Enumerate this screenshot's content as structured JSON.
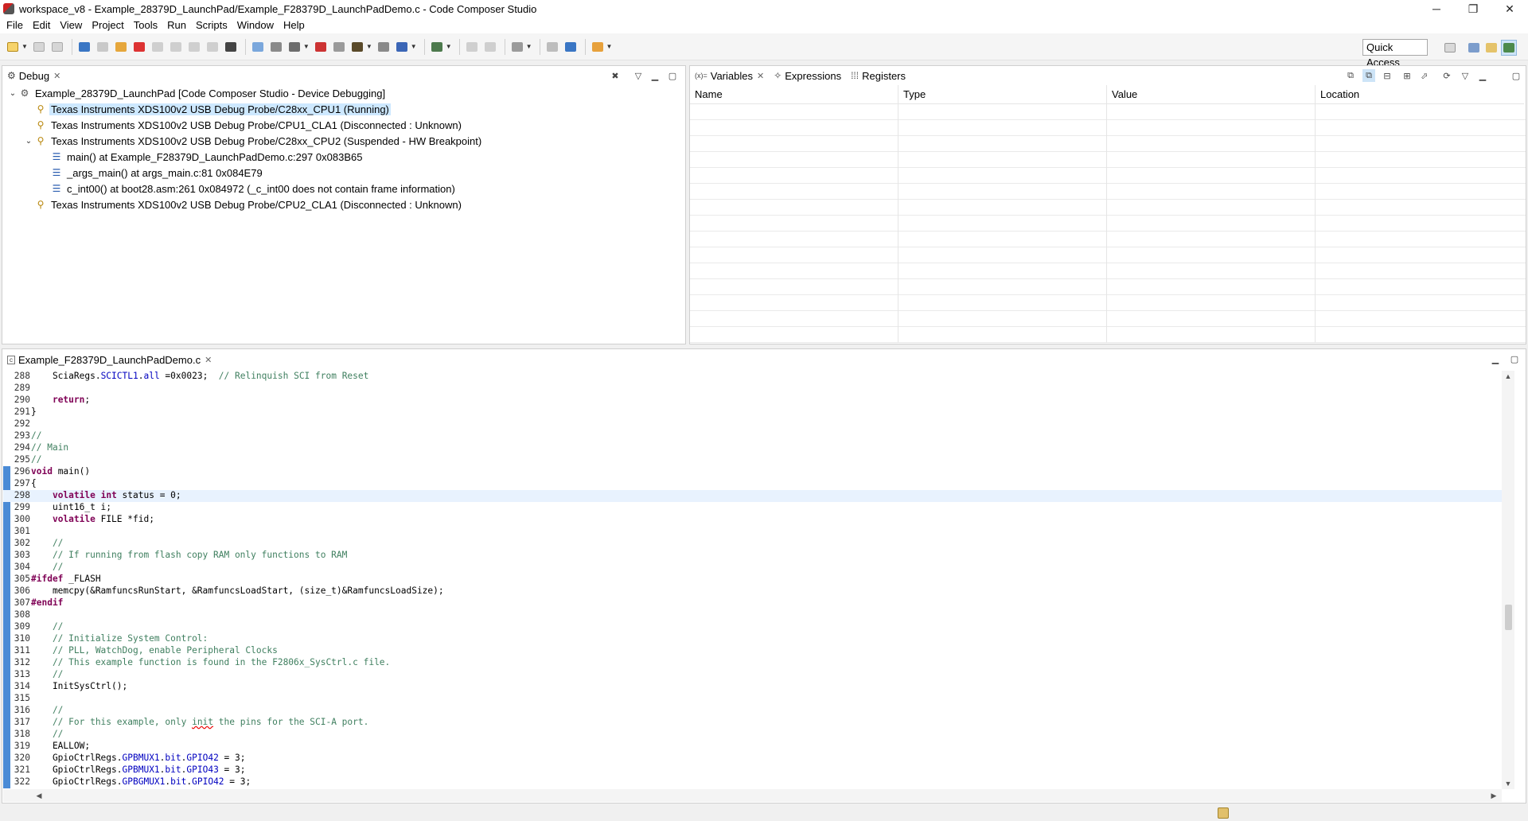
{
  "window": {
    "title": "workspace_v8 - Example_28379D_LaunchPad/Example_F28379D_LaunchPadDemo.c - Code Composer Studio",
    "minimize": "─",
    "restore": "❐",
    "close": "✕"
  },
  "menu": [
    "File",
    "Edit",
    "View",
    "Project",
    "Tools",
    "Run",
    "Scripts",
    "Window",
    "Help"
  ],
  "toolbar": {
    "quick_access": "Quick Access",
    "icons": [
      "new-icon",
      "save-icon",
      "save-all-icon",
      "debug-view-icon",
      "resume-icon",
      "suspend-icon",
      "terminate-icon",
      "step-into-icon",
      "step-over-icon",
      "step-return-icon",
      "reset-icon",
      "memory-browser-icon",
      "connect-icon",
      "flash-icon",
      "breakpoint-icon",
      "skip-breakpoints-icon",
      "build-icon",
      "launch-icon",
      "load-program-icon",
      "settings-gear-icon",
      "assembly-step-into-icon",
      "assembly-step-over-icon",
      "tools-icon",
      "console-icon",
      "search-icon",
      "external-tools-icon"
    ],
    "perspectives": [
      "open-perspective-icon",
      "ccs-edit-perspective-icon",
      "ccs-simple-perspective-icon",
      "ccs-debug-perspective-icon"
    ]
  },
  "debug_view": {
    "tab_label": "Debug",
    "tree": [
      {
        "label": "Example_28379D_LaunchPad [Code Composer Studio - Device Debugging]",
        "level": 0,
        "twisty": "⌄",
        "icon": "launch-config-icon",
        "selected": false
      },
      {
        "label": "Texas Instruments XDS100v2 USB Debug Probe/C28xx_CPU1 (Running)",
        "level": 1,
        "twisty": "",
        "icon": "running-thread-icon",
        "selected": true
      },
      {
        "label": "Texas Instruments XDS100v2 USB Debug Probe/CPU1_CLA1 (Disconnected : Unknown)",
        "level": 1,
        "twisty": "",
        "icon": "disconnected-target-icon",
        "selected": false
      },
      {
        "label": "Texas Instruments XDS100v2 USB Debug Probe/C28xx_CPU2 (Suspended - HW Breakpoint)",
        "level": 1,
        "twisty": "⌄",
        "icon": "suspended-thread-icon",
        "selected": false
      },
      {
        "label": "main() at Example_F28379D_LaunchPadDemo.c:297 0x083B65",
        "level": 2,
        "twisty": "",
        "icon": "stack-frame-icon",
        "selected": false
      },
      {
        "label": "_args_main() at args_main.c:81 0x084E79",
        "level": 2,
        "twisty": "",
        "icon": "stack-frame-icon",
        "selected": false
      },
      {
        "label": "c_int00() at boot28.asm:261 0x084972  (_c_int00 does not contain frame information)",
        "level": 2,
        "twisty": "",
        "icon": "stack-frame-icon",
        "selected": false
      },
      {
        "label": "Texas Instruments XDS100v2 USB Debug Probe/CPU2_CLA1 (Disconnected : Unknown)",
        "level": 1,
        "twisty": "",
        "icon": "disconnected-target-icon",
        "selected": false
      }
    ]
  },
  "variables_view": {
    "tabs": [
      {
        "label": "Variables",
        "icon": "(x)=",
        "closable": true
      },
      {
        "label": "Expressions",
        "icon": "✧",
        "closable": false
      },
      {
        "label": "Registers",
        "icon": "⁞⁞⁞",
        "closable": false
      }
    ],
    "columns": [
      "Name",
      "Type",
      "Value",
      "Location"
    ]
  },
  "editor": {
    "tab_label": "Example_F28379D_LaunchPadDemo.c",
    "current_line": 298,
    "lines": [
      {
        "n": "288",
        "segs": [
          [
            "",
            "    SciaRegs."
          ],
          [
            "fld",
            "SCICTL1"
          ],
          [
            "",
            "."
          ],
          [
            "fld",
            "all"
          ],
          [
            "",
            " =0x0023;  "
          ],
          [
            "cm",
            "// Relinquish SCI from Reset"
          ]
        ]
      },
      {
        "n": "289",
        "segs": [
          [
            "",
            ""
          ]
        ]
      },
      {
        "n": "290",
        "segs": [
          [
            "",
            "    "
          ],
          [
            "kw",
            "return"
          ],
          [
            "",
            ";"
          ]
        ]
      },
      {
        "n": "291",
        "segs": [
          [
            "",
            "}"
          ]
        ]
      },
      {
        "n": "292",
        "segs": [
          [
            "",
            ""
          ]
        ]
      },
      {
        "n": "293",
        "segs": [
          [
            "cm",
            "//"
          ]
        ]
      },
      {
        "n": "294",
        "segs": [
          [
            "cm",
            "// Main"
          ]
        ]
      },
      {
        "n": "295",
        "segs": [
          [
            "cm",
            "//"
          ]
        ]
      },
      {
        "n": "296",
        "segs": [
          [
            "kw",
            "void"
          ],
          [
            "",
            " main()"
          ]
        ]
      },
      {
        "n": "297",
        "segs": [
          [
            "",
            "{"
          ]
        ]
      },
      {
        "n": "298",
        "segs": [
          [
            "",
            "    "
          ],
          [
            "kw",
            "volatile"
          ],
          [
            "",
            " "
          ],
          [
            "kw",
            "int"
          ],
          [
            "",
            " status = 0;"
          ]
        ]
      },
      {
        "n": "299",
        "segs": [
          [
            "",
            "    uint16_t i;"
          ]
        ]
      },
      {
        "n": "300",
        "segs": [
          [
            "",
            "    "
          ],
          [
            "kw",
            "volatile"
          ],
          [
            "",
            " FILE *fid;"
          ]
        ]
      },
      {
        "n": "301",
        "segs": [
          [
            "",
            ""
          ]
        ]
      },
      {
        "n": "302",
        "segs": [
          [
            "cm",
            "    //"
          ]
        ]
      },
      {
        "n": "303",
        "segs": [
          [
            "cm",
            "    // If running from flash copy RAM only functions to RAM"
          ]
        ]
      },
      {
        "n": "304",
        "segs": [
          [
            "cm",
            "    //"
          ]
        ]
      },
      {
        "n": "305",
        "segs": [
          [
            "kw",
            "#ifdef"
          ],
          [
            "",
            " _FLASH"
          ]
        ]
      },
      {
        "n": "306",
        "segs": [
          [
            "",
            "    memcpy(&RamfuncsRunStart, &RamfuncsLoadStart, (size_t)&RamfuncsLoadSize);"
          ]
        ]
      },
      {
        "n": "307",
        "segs": [
          [
            "kw",
            "#endif"
          ]
        ]
      },
      {
        "n": "308",
        "segs": [
          [
            "",
            ""
          ]
        ]
      },
      {
        "n": "309",
        "segs": [
          [
            "cm",
            "    //"
          ]
        ]
      },
      {
        "n": "310",
        "segs": [
          [
            "cm",
            "    // Initialize System Control:"
          ]
        ]
      },
      {
        "n": "311",
        "segs": [
          [
            "cm",
            "    // PLL, WatchDog, enable Peripheral Clocks"
          ]
        ]
      },
      {
        "n": "312",
        "segs": [
          [
            "cm",
            "    // This example function is found in the F2806x_SysCtrl.c file."
          ]
        ]
      },
      {
        "n": "313",
        "segs": [
          [
            "cm",
            "    //"
          ]
        ]
      },
      {
        "n": "314",
        "segs": [
          [
            "",
            "    InitSysCtrl();"
          ]
        ]
      },
      {
        "n": "315",
        "segs": [
          [
            "",
            ""
          ]
        ]
      },
      {
        "n": "316",
        "segs": [
          [
            "cm",
            "    //"
          ]
        ]
      },
      {
        "n": "317",
        "segs": [
          [
            "cm",
            "    // For this example, only "
          ],
          [
            "cm squig",
            "init"
          ],
          [
            "cm",
            " the pins for the SCI-A port."
          ]
        ]
      },
      {
        "n": "318",
        "segs": [
          [
            "cm",
            "    //"
          ]
        ]
      },
      {
        "n": "319",
        "segs": [
          [
            "",
            "    EALLOW;"
          ]
        ]
      },
      {
        "n": "320",
        "segs": [
          [
            "",
            "    GpioCtrlRegs."
          ],
          [
            "fld",
            "GPBMUX1"
          ],
          [
            "",
            "."
          ],
          [
            "fld",
            "bit"
          ],
          [
            "",
            "."
          ],
          [
            "fld",
            "GPIO42"
          ],
          [
            "",
            " = 3;"
          ]
        ]
      },
      {
        "n": "321",
        "segs": [
          [
            "",
            "    GpioCtrlRegs."
          ],
          [
            "fld",
            "GPBMUX1"
          ],
          [
            "",
            "."
          ],
          [
            "fld",
            "bit"
          ],
          [
            "",
            "."
          ],
          [
            "fld",
            "GPIO43"
          ],
          [
            "",
            " = 3;"
          ]
        ]
      },
      {
        "n": "322",
        "segs": [
          [
            "",
            "    GpioCtrlRegs."
          ],
          [
            "fld",
            "GPBGMUX1"
          ],
          [
            "",
            "."
          ],
          [
            "fld",
            "bit"
          ],
          [
            "",
            "."
          ],
          [
            "fld",
            "GPIO42"
          ],
          [
            "",
            " = 3;"
          ]
        ]
      }
    ]
  }
}
